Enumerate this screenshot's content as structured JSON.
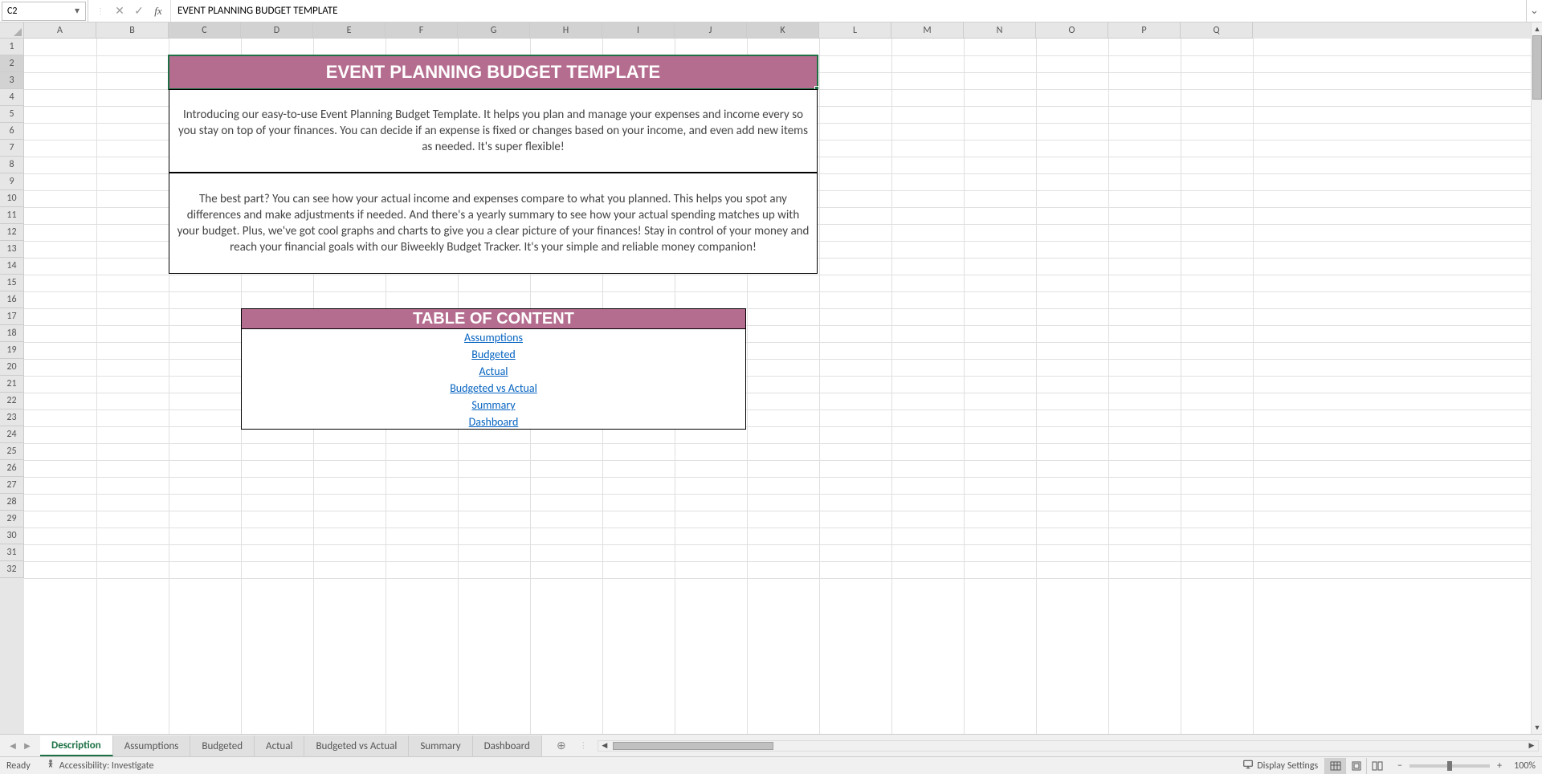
{
  "name_box": "C2",
  "formula_value": "EVENT PLANNING BUDGET TEMPLATE",
  "columns": [
    "A",
    "B",
    "C",
    "D",
    "E",
    "F",
    "G",
    "H",
    "I",
    "J",
    "K",
    "L",
    "M",
    "N",
    "O",
    "P",
    "Q"
  ],
  "selected_cols": [
    "C",
    "D",
    "E",
    "F",
    "G",
    "H",
    "I",
    "J",
    "K"
  ],
  "rows": [
    1,
    2,
    3,
    4,
    5,
    6,
    7,
    8,
    9,
    10,
    11,
    12,
    13,
    14,
    15,
    16,
    17,
    18,
    19,
    20,
    21,
    22,
    23,
    24,
    25,
    26,
    27,
    28,
    29,
    30,
    31,
    32
  ],
  "selected_rows": [
    2,
    3
  ],
  "content": {
    "title": "EVENT PLANNING BUDGET TEMPLATE",
    "para1": "Introducing our easy-to-use Event Planning Budget Template. It helps you plan and manage your expenses and income every so you stay on top of your finances. You can decide if an expense is fixed or changes based on your income, and even add new items as needed. It's super flexible!",
    "para2": "The best part? You can see how your actual income and expenses compare to what you planned. This helps you spot any differences and make adjustments if needed. And there's a yearly summary to see how your actual spending matches up with your budget. Plus, we've got cool graphs and charts to give you a clear picture of your finances! Stay in control of your money and reach your financial goals with our Biweekly Budget Tracker. It's your simple and reliable money companion!",
    "toc_title": "TABLE OF CONTENT",
    "toc_links": [
      "Assumptions",
      "Budgeted",
      "Actual",
      "Budgeted vs Actual",
      "Summary",
      "Dashboard"
    ]
  },
  "sheet_tabs": [
    "Description",
    "Assumptions",
    "Budgeted",
    "Actual",
    "Budgeted vs Actual",
    "Summary",
    "Dashboard"
  ],
  "active_tab": "Description",
  "status": {
    "ready": "Ready",
    "accessibility": "Accessibility: Investigate",
    "display_settings": "Display Settings",
    "zoom": "100%"
  },
  "col_widths": {
    "A": 90,
    "B": 90,
    "C": 90,
    "D": 90,
    "E": 90,
    "F": 90,
    "G": 90,
    "H": 90,
    "I": 90,
    "J": 90,
    "K": 90,
    "L": 90,
    "M": 90,
    "N": 90,
    "O": 90,
    "P": 90,
    "Q": 90
  }
}
